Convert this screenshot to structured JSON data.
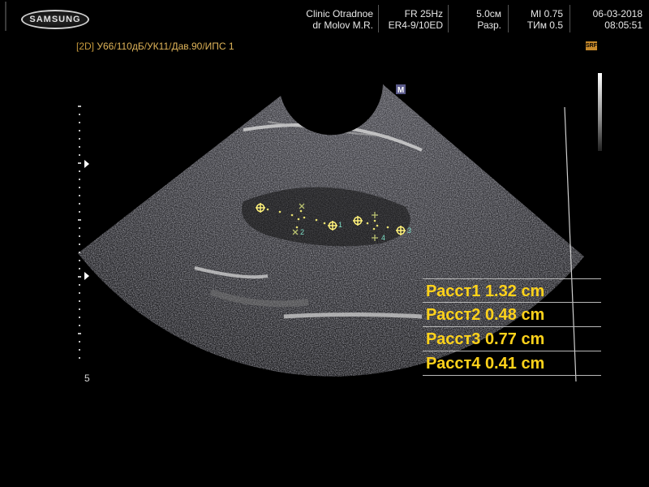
{
  "header": {
    "brand": "SAMSUNG",
    "clinic": "Clinic  Otradnoe",
    "doctor": "dr Molov M.R.",
    "frame_rate": "FR 25Hz",
    "probe": "ER4-9/10ED",
    "depth": "5.0см",
    "resolution": "Разр.",
    "mi": "MI  0.75",
    "tim": "TИм 0.5",
    "date": "06-03-2018",
    "time": "08:05:51"
  },
  "status_line": {
    "mode": "[2D]",
    "params": [
      {
        "text": "У66",
        "sep": "/"
      },
      {
        "text": "110дБ",
        "sep": "/"
      },
      {
        "text": "УК11",
        "sep": "/"
      },
      {
        "text": "Дав.90",
        "sep": "/"
      },
      {
        "text": "ИПС 1",
        "sep": ""
      }
    ],
    "srf_badge": "SRF"
  },
  "orientation_marker": "M",
  "depth_scale_label": "5",
  "measurements": [
    {
      "label": "Расст1",
      "value": "1.32",
      "unit": "cm"
    },
    {
      "label": "Расст2",
      "value": "0.48",
      "unit": "cm"
    },
    {
      "label": "Расст3",
      "value": "0.77",
      "unit": "cm"
    },
    {
      "label": "Расст4",
      "value": "0.41",
      "unit": "cm"
    }
  ],
  "calipers": [
    "1",
    "2",
    "3",
    "4"
  ],
  "colors": {
    "measurement_text": "#ffd21a",
    "status_text": "#c79a3c",
    "caliper_cross": "#fff27a",
    "caliper_label": "#7fe0c8",
    "background": "#000000"
  }
}
